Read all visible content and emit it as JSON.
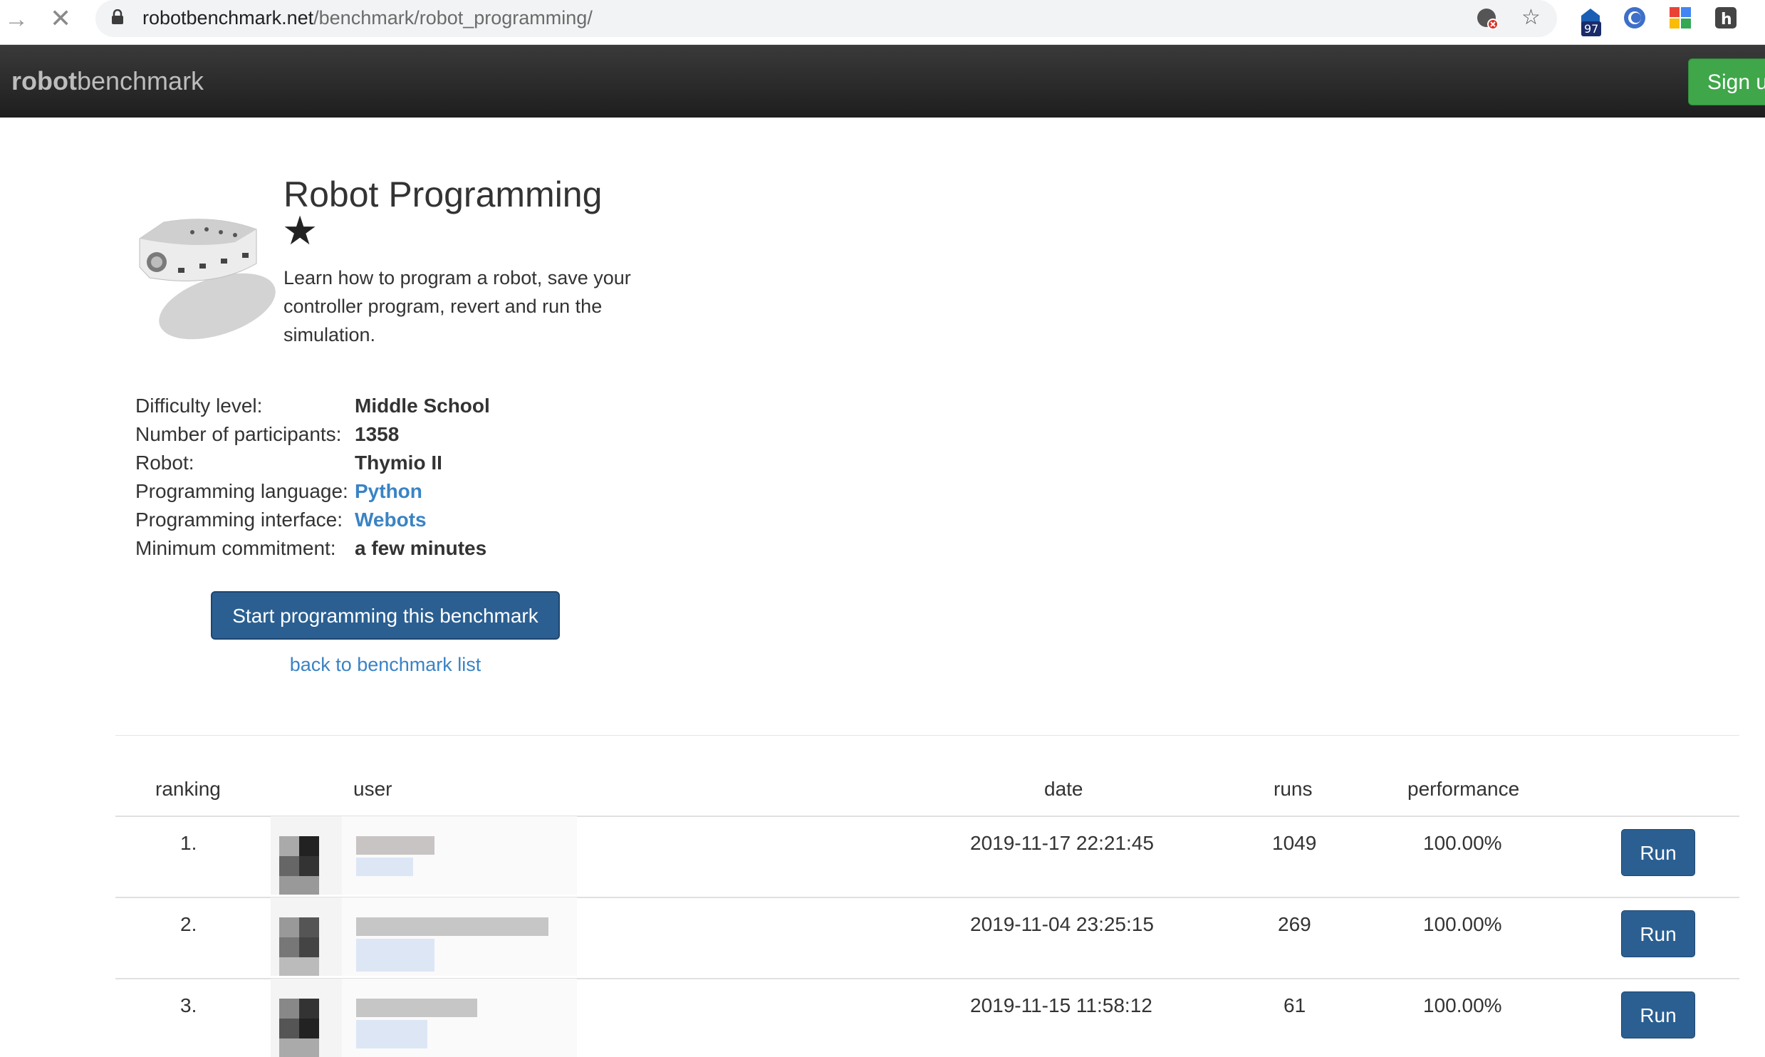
{
  "browser": {
    "url_host": "robotbenchmark.net",
    "url_path": "/benchmark/robot_programming/",
    "extension_badge": "97"
  },
  "navbar": {
    "brand_bold": "robot",
    "brand_rest": "benchmark",
    "signup_label": "Sign u"
  },
  "benchmark": {
    "title": "Robot Programming",
    "star": "★",
    "description": "Learn how to program a robot, save your controller program, revert and run the simulation."
  },
  "info": [
    {
      "label": "Difficulty level:",
      "value": "Middle School",
      "is_link": false
    },
    {
      "label": "Number of participants:",
      "value": "1358",
      "is_link": false
    },
    {
      "label": "Robot:",
      "value": "Thymio II",
      "is_link": false
    },
    {
      "label": "Programming language:",
      "value": "Python",
      "is_link": true
    },
    {
      "label": "Programming interface:",
      "value": "Webots",
      "is_link": true
    },
    {
      "label": "Minimum commitment:",
      "value": "a few minutes",
      "is_link": false
    }
  ],
  "actions": {
    "start_label": "Start programming this benchmark",
    "back_label": "back to benchmark list"
  },
  "table": {
    "headers": {
      "ranking": "ranking",
      "user": "user",
      "date": "date",
      "runs": "runs",
      "performance": "performance"
    },
    "rows": [
      {
        "ranking": "1.",
        "date": "2019-11-17 22:21:45",
        "runs": "1049",
        "performance": "100.00%",
        "run_label": "Run"
      },
      {
        "ranking": "2.",
        "date": "2019-11-04 23:25:15",
        "runs": "269",
        "performance": "100.00%",
        "run_label": "Run"
      },
      {
        "ranking": "3.",
        "date": "2019-11-15 11:58:12",
        "runs": "61",
        "performance": "100.00%",
        "run_label": "Run"
      }
    ]
  },
  "colors": {
    "link": "#3a83c5",
    "primary_button": "#2b5f91",
    "signup_button": "#3fa64a",
    "navbar": "#2a2a2a"
  },
  "icons": {
    "back": "arrow-right-icon",
    "stop": "close-icon",
    "lock": "lock-icon",
    "translate": "translate-icon",
    "bookmark": "star-outline-icon"
  }
}
